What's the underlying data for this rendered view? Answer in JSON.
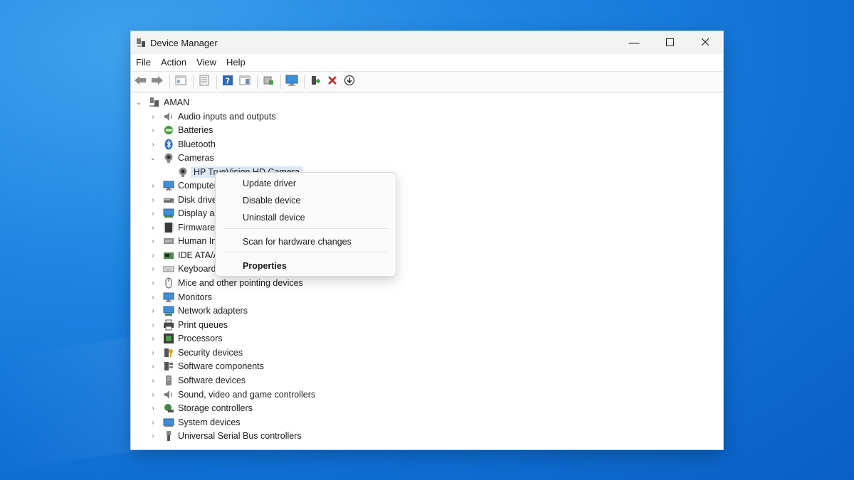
{
  "window": {
    "title": "Device Manager"
  },
  "menubar": {
    "items": [
      "File",
      "Action",
      "View",
      "Help"
    ]
  },
  "tree": {
    "root": "AMAN",
    "categories": [
      "Audio inputs and outputs",
      "Batteries",
      "Bluetooth",
      "Cameras",
      "Computer",
      "Disk drives",
      "Display adapters",
      "Firmware",
      "Human Interface Devices",
      "IDE ATA/ATAPI controllers",
      "Keyboards",
      "Mice and other pointing devices",
      "Monitors",
      "Network adapters",
      "Print queues",
      "Processors",
      "Security devices",
      "Software components",
      "Software devices",
      "Sound, video and game controllers",
      "Storage controllers",
      "System devices",
      "Universal Serial Bus controllers"
    ],
    "camera_child": "HP TrueVision HD Camera"
  },
  "context_menu": {
    "update": "Update driver",
    "disable": "Disable device",
    "uninstall": "Uninstall device",
    "scan": "Scan for hardware changes",
    "properties": "Properties"
  },
  "colors": {
    "selection": "#dbe8f7",
    "delete_red": "#d42020",
    "help_blue": "#2f66b8"
  }
}
